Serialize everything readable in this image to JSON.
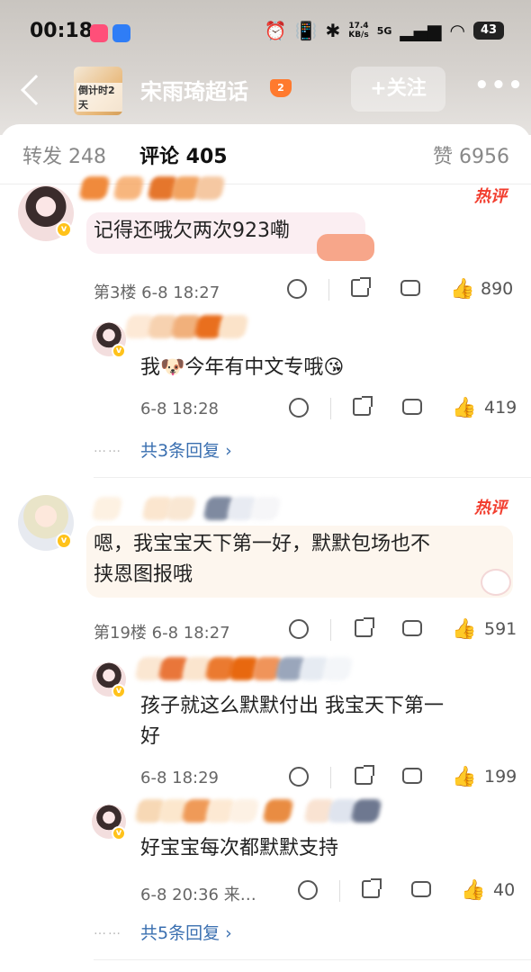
{
  "status_bar": {
    "time": "00:18",
    "net_speed_value": "17.4",
    "net_speed_unit": "KB/s",
    "signal_label": "5G",
    "battery": "43"
  },
  "nav": {
    "topic_title": "宋雨琦超话",
    "topic_badge": "2",
    "thumb_text": "倒计时2天",
    "follow_label": "+关注",
    "more_label": "•••"
  },
  "tabs": {
    "repost": "转发 248",
    "comments": "评论 405",
    "likes": "赞 6956"
  },
  "comments": [
    {
      "hot_tag": "热评",
      "text": "记得还哦欠两次923嘞",
      "floor_time": "第3楼  6-8 18:27",
      "likes": "890",
      "reply": {
        "text": "我🐶今年有中文专哦😘",
        "time": "6-8 18:28",
        "likes": "419"
      },
      "more_replies": "共3条回复 ›"
    },
    {
      "hot_tag": "热评",
      "text_line1": "嗯，我宝宝天下第一好，默默包场也不",
      "text_line2": "挟恩图报哦",
      "floor_time": "第19楼  6-8 18:27",
      "likes": "591",
      "replies": [
        {
          "text_line1": "孩子就这么默默付出 我宝天下第一",
          "text_line2": "好",
          "time": "6-8 18:29",
          "likes": "199"
        },
        {
          "text": "好宝宝每次都默默支持",
          "time": "6-8 20:36  来…",
          "likes": "40"
        }
      ],
      "more_replies": "共5条回复 ›"
    }
  ],
  "icons": {
    "back": "chevron-left-icon",
    "dislike": "frown-face-icon",
    "share": "share-icon",
    "comment": "comment-bubble-icon",
    "like": "thumbs-up-icon",
    "verified": "verified-v-icon"
  },
  "colors": {
    "hot_tag": "#f23d2e",
    "link": "#3a6fb0",
    "verified": "#ffc21a"
  }
}
